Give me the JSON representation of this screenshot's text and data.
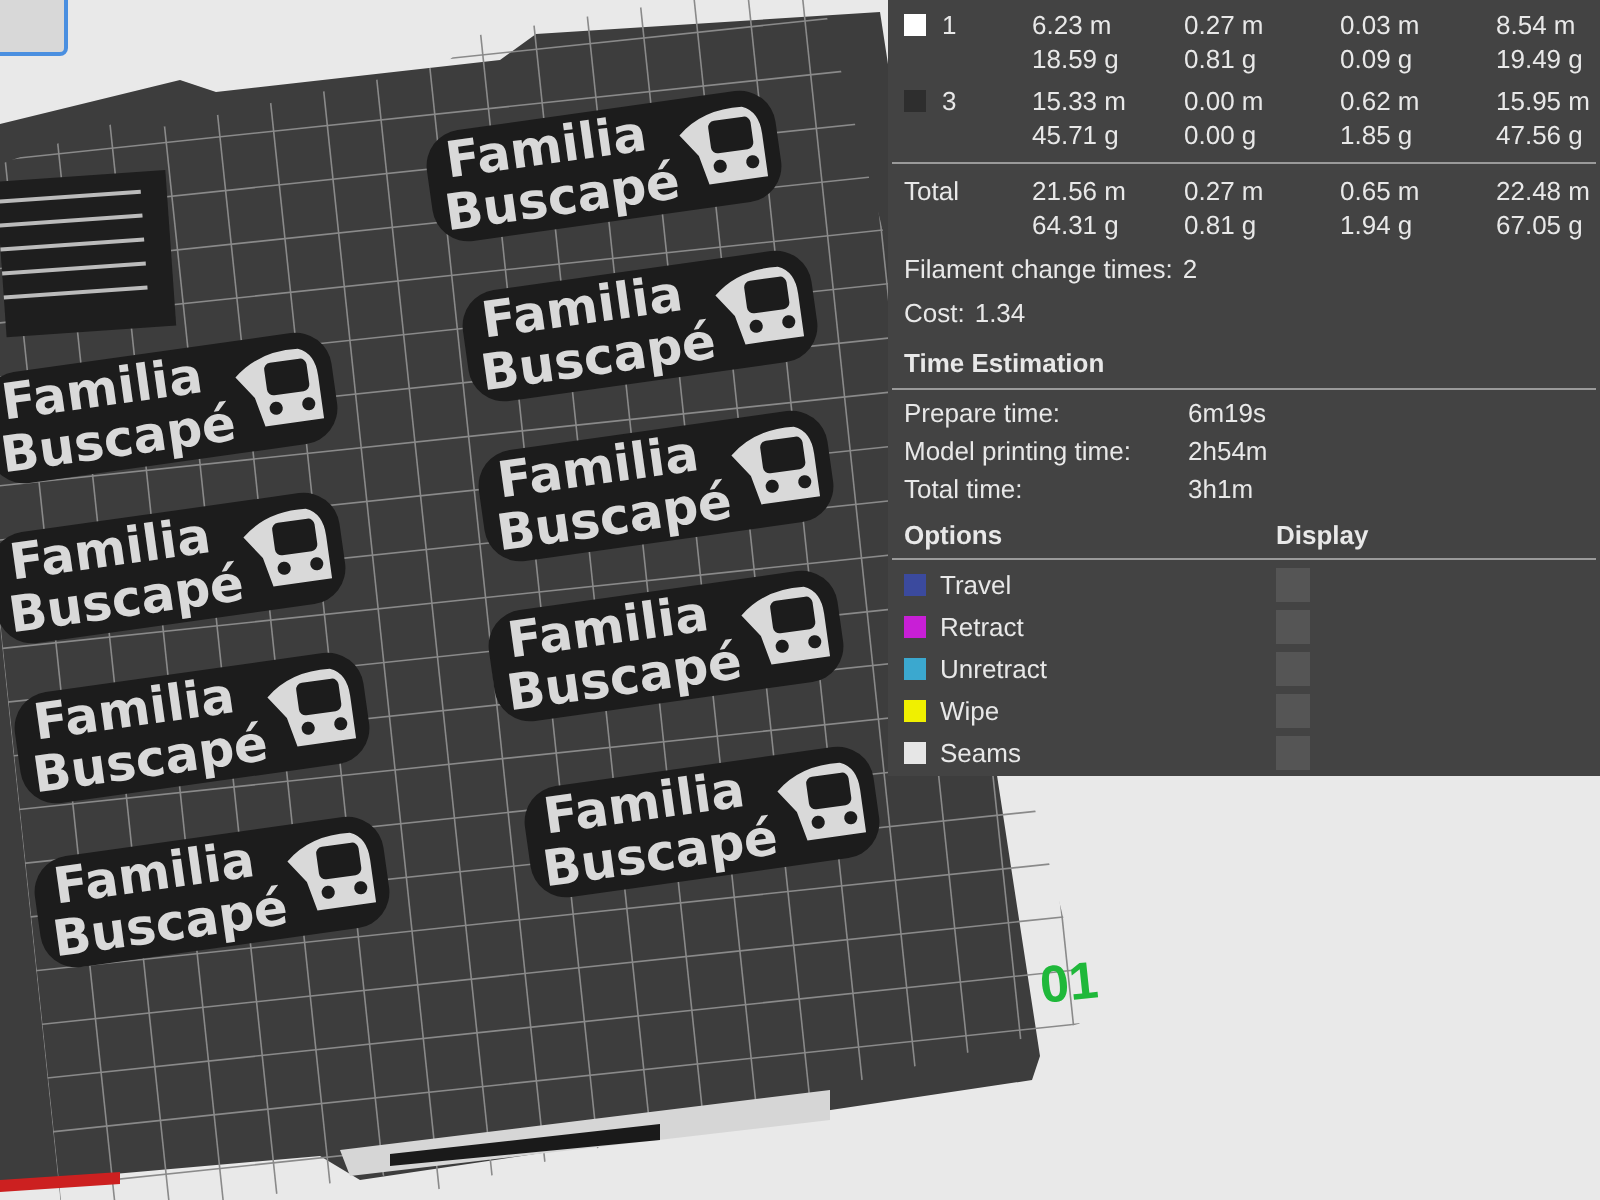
{
  "scene": {
    "plate_number": "01",
    "models": [
      {
        "line_1": "Familia",
        "line_2": "Buscapé"
      },
      {
        "line_1": "Familia",
        "line_2": "Buscapé"
      },
      {
        "line_1": "Familia",
        "line_2": "Buscapé"
      },
      {
        "line_1": "Familia",
        "line_2": "Buscapé"
      },
      {
        "line_1": "Familia",
        "line_2": "Buscapé"
      },
      {
        "line_1": "Familia",
        "line_2": "Buscapé"
      },
      {
        "line_1": "Familia",
        "line_2": "Buscapé"
      },
      {
        "line_1": "Familia",
        "line_2": "Buscapé"
      },
      {
        "line_1": "Familia",
        "line_2": "Buscapé"
      }
    ]
  },
  "filament_table": {
    "rows": [
      {
        "id": "1",
        "color": "#ffffff",
        "lengths": [
          "6.23 m",
          "0.27 m",
          "0.03 m",
          "8.54 m"
        ],
        "weights": [
          "18.59 g",
          "0.81 g",
          "0.09 g",
          "19.49 g"
        ]
      },
      {
        "id": "3",
        "color": "#2e2e2e",
        "lengths": [
          "15.33 m",
          "0.00 m",
          "0.62 m",
          "15.95 m"
        ],
        "weights": [
          "45.71 g",
          "0.00 g",
          "1.85 g",
          "47.56 g"
        ]
      }
    ],
    "total": {
      "label": "Total",
      "lengths": [
        "21.56 m",
        "0.27 m",
        "0.65 m",
        "22.48 m"
      ],
      "weights": [
        "64.31 g",
        "0.81 g",
        "1.94 g",
        "67.05 g"
      ]
    }
  },
  "filament_change": {
    "label": "Filament change times:",
    "value": "2"
  },
  "cost": {
    "label": "Cost:",
    "value": "1.34"
  },
  "time_estimation": {
    "title": "Time Estimation",
    "rows": [
      {
        "label": "Prepare time:",
        "value": "6m19s"
      },
      {
        "label": "Model printing time:",
        "value": "2h54m"
      },
      {
        "label": "Total time:",
        "value": "3h1m"
      }
    ]
  },
  "options": {
    "heading": "Options",
    "display_heading": "Display",
    "items": [
      {
        "label": "Travel",
        "color": "#3b4a9e",
        "checked": false
      },
      {
        "label": "Retract",
        "color": "#c81fd6",
        "checked": false
      },
      {
        "label": "Unretract",
        "color": "#3ba8cf",
        "checked": false
      },
      {
        "label": "Wipe",
        "color": "#f0f000",
        "checked": false
      },
      {
        "label": "Seams",
        "color": "#e6e6e6",
        "checked": false
      }
    ]
  }
}
